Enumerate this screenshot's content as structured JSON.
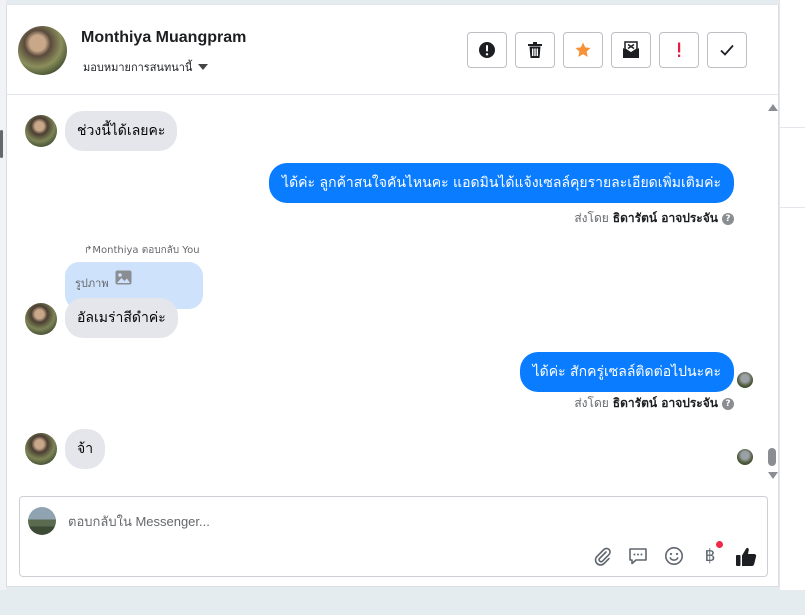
{
  "header": {
    "contact_name": "Monthiya Muangpram",
    "assign_label": "มอบหมายการสนทนานี้"
  },
  "actions": [
    {
      "name": "spam-button",
      "icon": "alert-circle-icon"
    },
    {
      "name": "delete-button",
      "icon": "trash-icon"
    },
    {
      "name": "star-button",
      "icon": "star-icon",
      "color": "#f7923a"
    },
    {
      "name": "mark-unread-button",
      "icon": "envelope-x-icon"
    },
    {
      "name": "follow-up-button",
      "icon": "exclamation-icon",
      "color": "#e41e3f"
    },
    {
      "name": "done-button",
      "icon": "check-icon"
    }
  ],
  "messages": [
    {
      "id": "m1",
      "direction": "in",
      "text": "ช่วงนี้ได้เลยคะ"
    },
    {
      "id": "m2",
      "direction": "out",
      "text": "ได้ค่ะ ลูกค้าสนใจคันไหนคะ แอดมินได้แจ้งเซลล์คุยรายละเอียดเพิ่มเติมค่ะ",
      "sent_prefix": "ส่งโดย",
      "sent_by": "ธิดารัตน์ อาจประจัน"
    },
    {
      "id": "m3",
      "direction": "in",
      "reply_note": "Monthiya ตอบกลับ You",
      "quoted_label": "รูปภาพ",
      "text": "อัลเมร่าสีดำค่ะ"
    },
    {
      "id": "m4",
      "direction": "out",
      "text": "ได้ค่ะ สักครู่เซลล์ติดต่อไปนะคะ",
      "sent_prefix": "ส่งโดย",
      "sent_by": "ธิดารัตน์ อาจประจัน"
    },
    {
      "id": "m5",
      "direction": "in",
      "text": "จ้า"
    }
  ],
  "composer": {
    "placeholder": "ตอบกลับใน Messenger...",
    "tools": [
      "paperclip-icon",
      "chat-bubble-icon",
      "emoji-icon",
      "baht-icon",
      "thumbs-up-icon"
    ]
  },
  "colors": {
    "outgoing_bubble": "#0a7cff",
    "incoming_bubble": "#e4e6eb",
    "quoted_bubble": "#cfe2fb",
    "notification_dot": "#f02849"
  }
}
